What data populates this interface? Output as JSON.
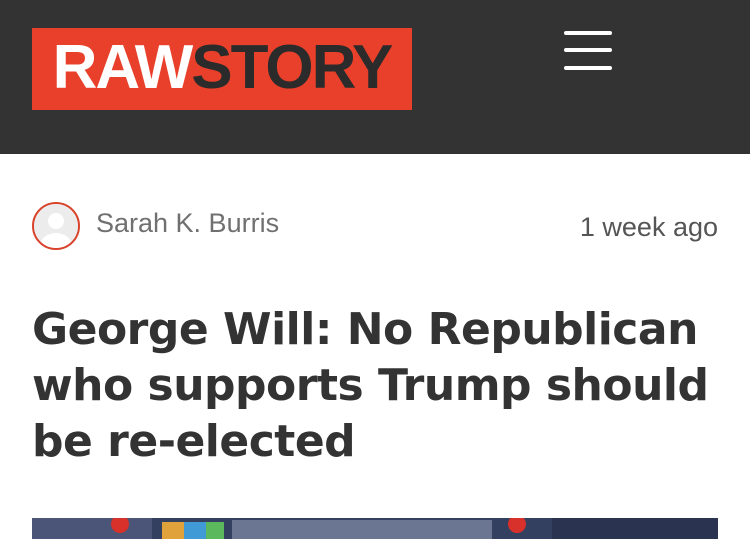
{
  "header": {
    "logo": {
      "part_white": "RAW",
      "part_dark": "STORY"
    },
    "background_color": "#333333",
    "brand_color": "#e8402a",
    "menu_icon": "hamburger-menu-icon"
  },
  "article": {
    "author": "Sarah K. Burris",
    "timestamp": "1 week ago",
    "headline": "George Will: No Republican who supports Trump should be re-elected",
    "avatar_icon": "default-user-avatar-icon"
  }
}
